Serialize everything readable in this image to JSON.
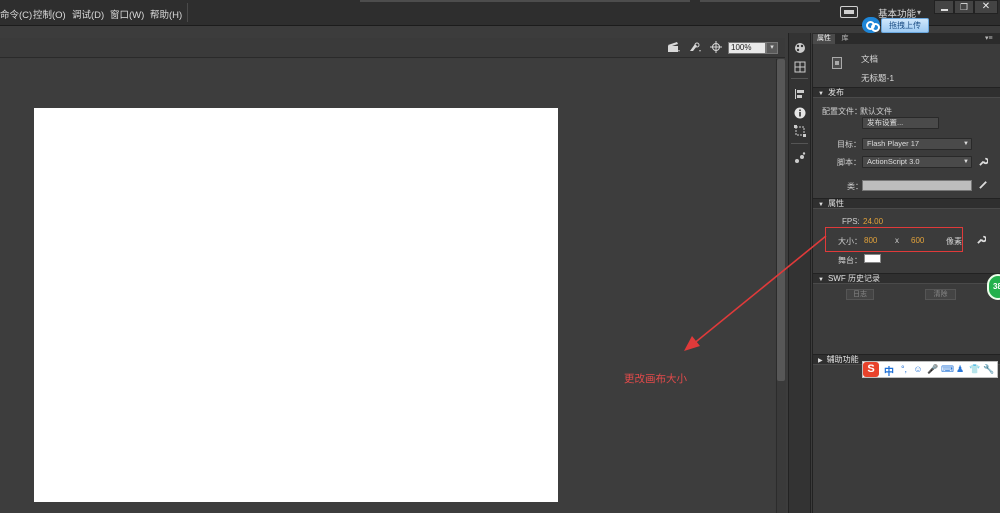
{
  "menubar": {
    "items": [
      "命令(C)",
      "控制(O)",
      "调试(D)",
      "窗口(W)",
      "帮助(H)"
    ],
    "workspace_label": "基本功能",
    "workspace_caret": "▾",
    "max_glyph": "❐",
    "close_glyph": "✕",
    "upload_label": "拖拽上传"
  },
  "stage_toolbar": {
    "zoom_value": "100%",
    "zoom_arrow": "▾"
  },
  "panel": {
    "tabs": [
      "属性",
      "库"
    ],
    "menu_glyph": "▾≡",
    "doc_type": "文档",
    "doc_name": "无标题-1",
    "publish": {
      "header": "发布",
      "profile_label": "配置文件：",
      "profile_value": "默认文件",
      "settings_button": "发布设置...",
      "target_label": "目标：",
      "target_value": "Flash Player 17",
      "script_label": "脚本：",
      "script_value": "ActionScript 3.0",
      "class_label": "类："
    },
    "properties": {
      "header": "属性",
      "fps_label": "FPS:",
      "fps_value": "24.00",
      "size_label": "大小：",
      "width_value": "800",
      "x_sep": "x",
      "height_value": "600",
      "unit_label": "像素",
      "stage_label": "舞台："
    },
    "swf_history": {
      "header": "SWF 历史记录",
      "log_button": "日志",
      "clear_button": "清除"
    },
    "accessibility": {
      "header": "辅助功能"
    },
    "collapse_glyph": "▼",
    "expand_glyph": "▶",
    "dropdown_glyph": "▼"
  },
  "annotation": {
    "text": "更改画布大小",
    "color": "#e03a3a"
  },
  "ime": {
    "logo": "S",
    "lang": "中",
    "icons": [
      "°,",
      "☺",
      "🎤",
      "⌨",
      "♟",
      "👕",
      "🔧"
    ]
  },
  "badge": {
    "text": "38"
  }
}
